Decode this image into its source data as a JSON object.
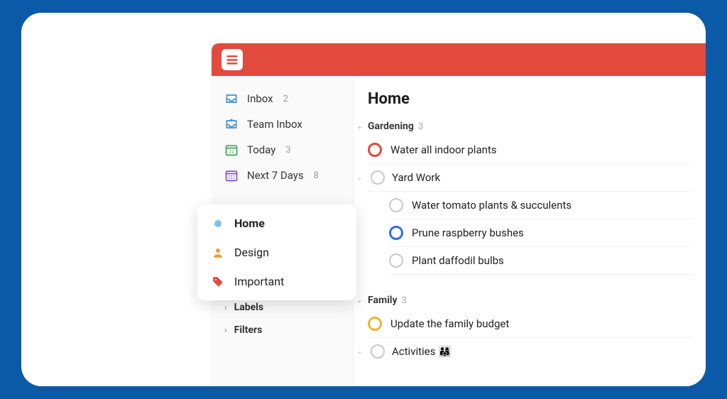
{
  "sidebar": {
    "inbox": {
      "label": "Inbox",
      "count": "2"
    },
    "team_inbox": {
      "label": "Team Inbox"
    },
    "today": {
      "label": "Today",
      "count": "3"
    },
    "next7": {
      "label": "Next 7 Days",
      "count": "8"
    },
    "labels_header": "Labels",
    "filters_header": "Filters"
  },
  "favorites": {
    "home": {
      "label": "Home"
    },
    "design": {
      "label": "Design"
    },
    "important": {
      "label": "Important"
    }
  },
  "page": {
    "title": "Home"
  },
  "sections": {
    "gardening": {
      "label": "Gardening",
      "count": "3",
      "tasks": {
        "water_indoor": "Water all indoor plants",
        "yard_work": "Yard Work",
        "water_tomato": "Water tomato plants & succulents",
        "prune": "Prune raspberry bushes",
        "daffodil": "Plant daffodil bulbs"
      }
    },
    "family": {
      "label": "Family",
      "count": "3",
      "tasks": {
        "budget": "Update the family budget",
        "activities": "Activities 👨‍👩‍👧"
      }
    }
  }
}
